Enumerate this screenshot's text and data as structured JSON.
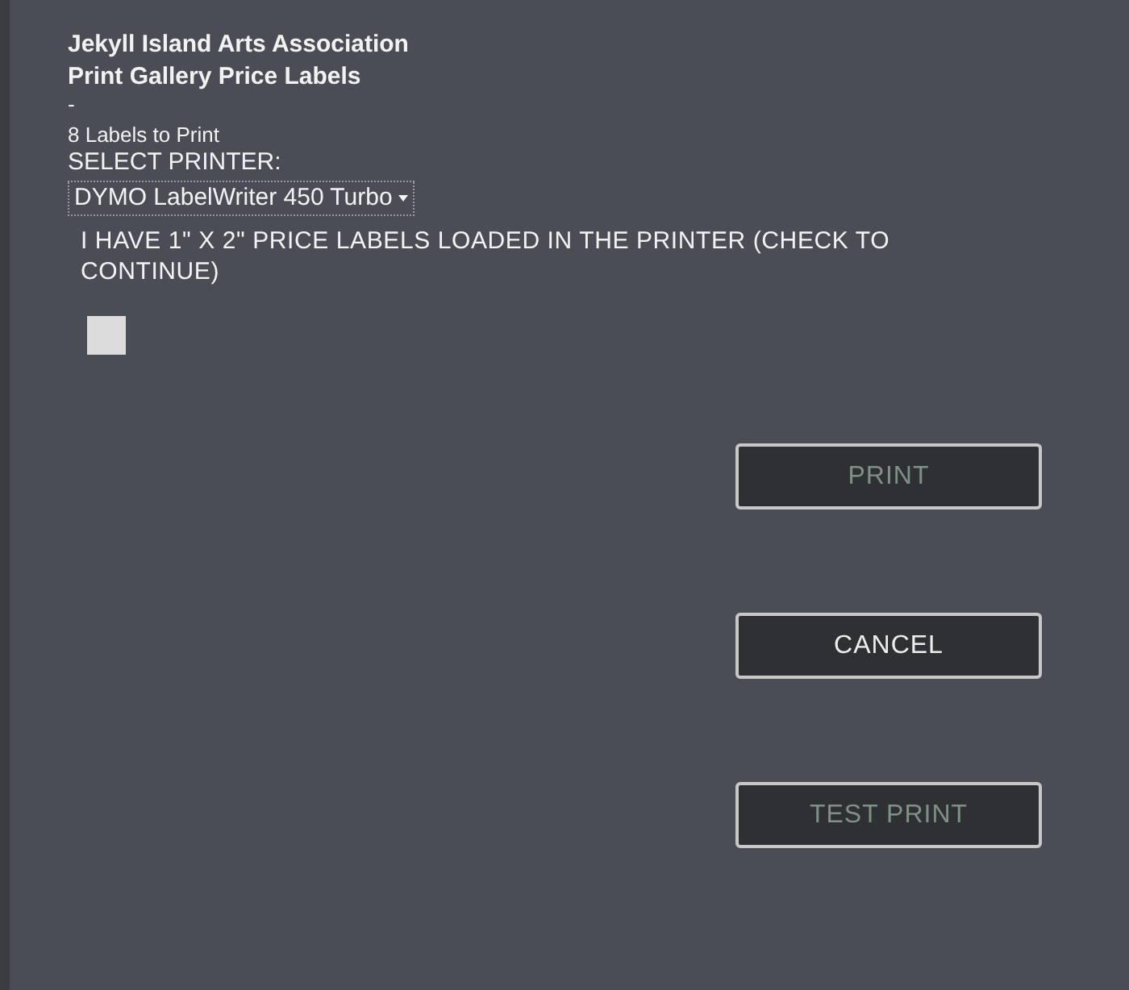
{
  "header": {
    "title": "Jekyll Island Arts Association",
    "subtitle": "Print Gallery Price Labels",
    "separator": "-"
  },
  "label_count": "8 Labels to Print",
  "printer_label": "SELECT PRINTER:",
  "printer_select": {
    "value": "DYMO LabelWriter 450 Turbo"
  },
  "confirm": {
    "text": "I HAVE 1\" X 2\" PRICE LABELS LOADED IN THE PRINTER (CHECK TO CONTINUE)",
    "checked": false
  },
  "buttons": [
    {
      "label": "PRINT",
      "disabled": true
    },
    {
      "label": "CANCEL",
      "disabled": false
    },
    {
      "label": "TEST PRINT",
      "disabled": true
    }
  ]
}
